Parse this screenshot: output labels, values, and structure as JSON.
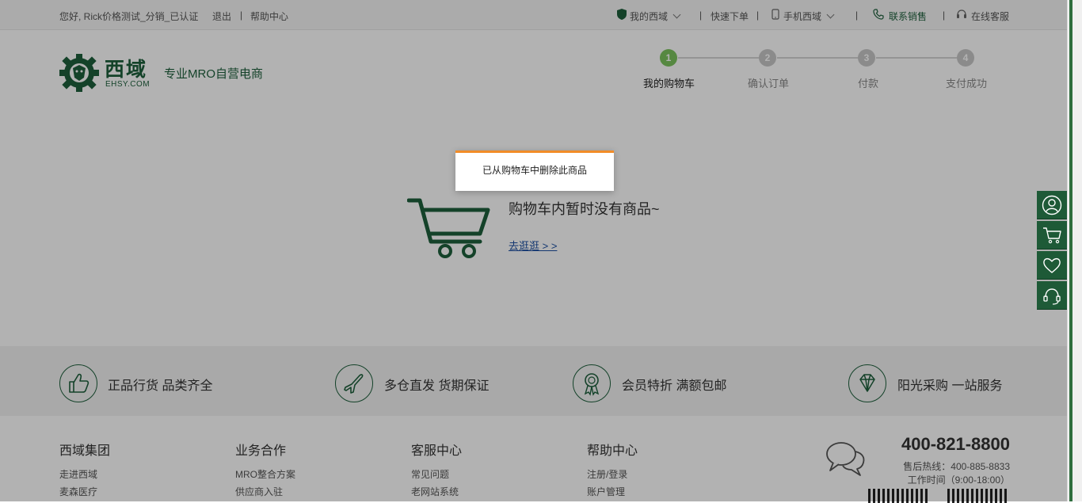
{
  "topbar": {
    "greeting": "您好, Rick价格测试_分销_已认证",
    "logout": "退出",
    "sep": "|",
    "help": "帮助中心",
    "my_ehsy": "我的西域",
    "quick_order": "快速下单",
    "mobile": "手机西域",
    "contact_sales": "联系销售",
    "online_service": "在线客服",
    "accent": "#1d5f3c"
  },
  "header": {
    "logo_cn": "西域",
    "logo_en": "EHSY.COM",
    "tagline": "专业MRO自营电商"
  },
  "steps": [
    {
      "num": "1",
      "label": "我的购物车"
    },
    {
      "num": "2",
      "label": "确认订单"
    },
    {
      "num": "3",
      "label": "付款"
    },
    {
      "num": "4",
      "label": "支付成功"
    }
  ],
  "cart": {
    "empty_text": "购物车内暂时没有商品~",
    "go_shopping": "去逛逛 > >"
  },
  "features": [
    {
      "icon": "thumbs-up-icon",
      "text": "正品行货   品类齐全"
    },
    {
      "icon": "airplane-icon",
      "text": "多仓直发   货期保证"
    },
    {
      "icon": "award-ribbon-icon",
      "text": "会员特折   满额包邮"
    },
    {
      "icon": "diamond-icon",
      "text": "阳光采购   一站服务"
    }
  ],
  "footer": {
    "columns": [
      {
        "title": "西域集团",
        "links": [
          "走进西域",
          "麦森医疗"
        ]
      },
      {
        "title": "业务合作",
        "links": [
          "MRO整合方案",
          "供应商入驻"
        ]
      },
      {
        "title": "客服中心",
        "links": [
          "常见问题",
          "老网站系统"
        ]
      },
      {
        "title": "帮助中心",
        "links": [
          "注册/登录",
          "账户管理"
        ]
      }
    ],
    "phone": "400-821-8800",
    "hotline": "售后热线：400-885-8833",
    "hours": "工作时间（9:00-18:00）"
  },
  "sidebar": [
    "user-icon",
    "cart-icon",
    "heart-icon",
    "headset-icon"
  ],
  "toast": {
    "message": "已从购物车中删除此商品",
    "accent": "#f28c28"
  }
}
